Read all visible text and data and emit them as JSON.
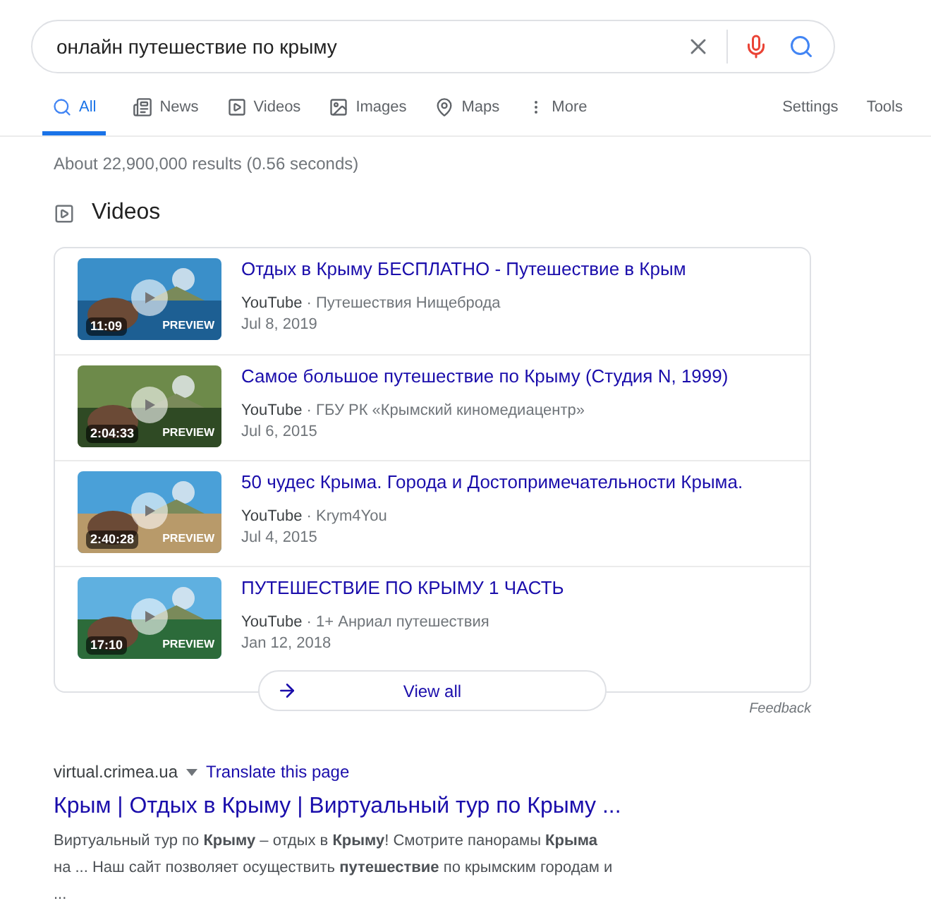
{
  "search": {
    "value": "онлайн путешествие по крыму"
  },
  "tabs": [
    {
      "label": "All",
      "kind": "all",
      "selected": true
    },
    {
      "label": "News",
      "kind": "news",
      "selected": false
    },
    {
      "label": "Videos",
      "kind": "videos",
      "selected": false
    },
    {
      "label": "Images",
      "kind": "images",
      "selected": false
    },
    {
      "label": "Maps",
      "kind": "maps",
      "selected": false
    },
    {
      "label": "More",
      "kind": "more",
      "selected": false
    }
  ],
  "tools": [
    "Settings",
    "Tools"
  ],
  "result_stats": "About 22,900,000 results (0.56 seconds)",
  "videos": {
    "heading": "Videos",
    "items": [
      {
        "title": "Отдых в Крыму БЕСПЛАТНО - Путешествие в Крым",
        "source": "YouTube",
        "channel": "· Путешествия Нищеброда",
        "date": "Jul 8, 2019",
        "duration": "11:09",
        "preview": "PREVIEW"
      },
      {
        "title": "Самое большое путешествие по Крыму (Студия N, 1999)",
        "source": "YouTube",
        "channel": "· ГБУ РК «Крымский киномедиацентр»",
        "date": "Jul 6, 2015",
        "duration": "2:04:33",
        "preview": "PREVIEW"
      },
      {
        "title": "50 чудес Крыма. Города и Достопримечательности Крыма.",
        "source": "YouTube",
        "channel": "· Krym4You",
        "date": "Jul 4, 2015",
        "duration": "2:40:28",
        "preview": "PREVIEW"
      },
      {
        "title": "ПУТЕШЕСТВИЕ ПО КРЫМУ 1 ЧАСТЬ",
        "source": "YouTube",
        "channel": "· 1+ Анриал путешествия",
        "date": "Jan 12, 2018",
        "duration": "17:10",
        "preview": "PREVIEW"
      }
    ],
    "view_all": "View all",
    "feedback": "Feedback"
  },
  "result": {
    "url": "virtual.crimea.ua",
    "translate": "Translate this page",
    "title": "Крым | Отдых в Крыму | Виртуальный тур по Крыму ...",
    "snippet": "Виртуальный тур по **Крыму** – отдых в **Крыму**! Смотрите панорамы **Крыма** на ... Наш сайт позволяет осуществить **путешествие** по крымским городам и ..."
  }
}
